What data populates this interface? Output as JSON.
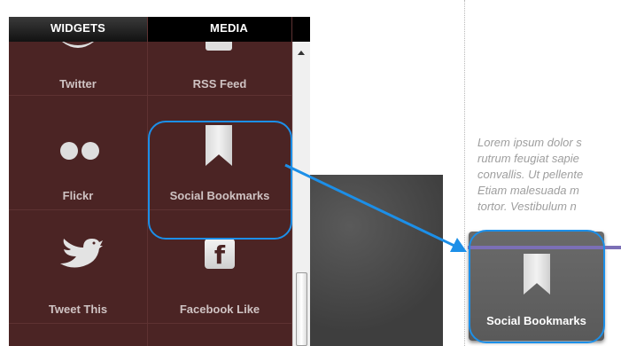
{
  "tabs": [
    {
      "label": "WIDGETS"
    },
    {
      "label": "MEDIA"
    }
  ],
  "widgets": [
    {
      "label": "Twitter",
      "icon": "twitter-icon"
    },
    {
      "label": "RSS Feed",
      "icon": "rss-icon"
    },
    {
      "label": "Flickr",
      "icon": "flickr-icon"
    },
    {
      "label": "Social Bookmarks",
      "icon": "bookmark-icon"
    },
    {
      "label": "Tweet This",
      "icon": "bird-icon"
    },
    {
      "label": "Facebook Like",
      "icon": "facebook-icon"
    }
  ],
  "facebook_glyph": "f",
  "preview": {
    "lorem_lines": [
      "Lorem ipsum dolor s",
      "rutrum feugiat sapie",
      "convallis. Ut pellente",
      "Etiam malesuada m",
      "tortor. Vestibulum n"
    ],
    "dropped_widget_label": "Social Bookmarks"
  },
  "colors": {
    "panel_bg": "#4b2424",
    "highlight": "#1c8fe8",
    "accent_line": "#7b6fb6"
  }
}
